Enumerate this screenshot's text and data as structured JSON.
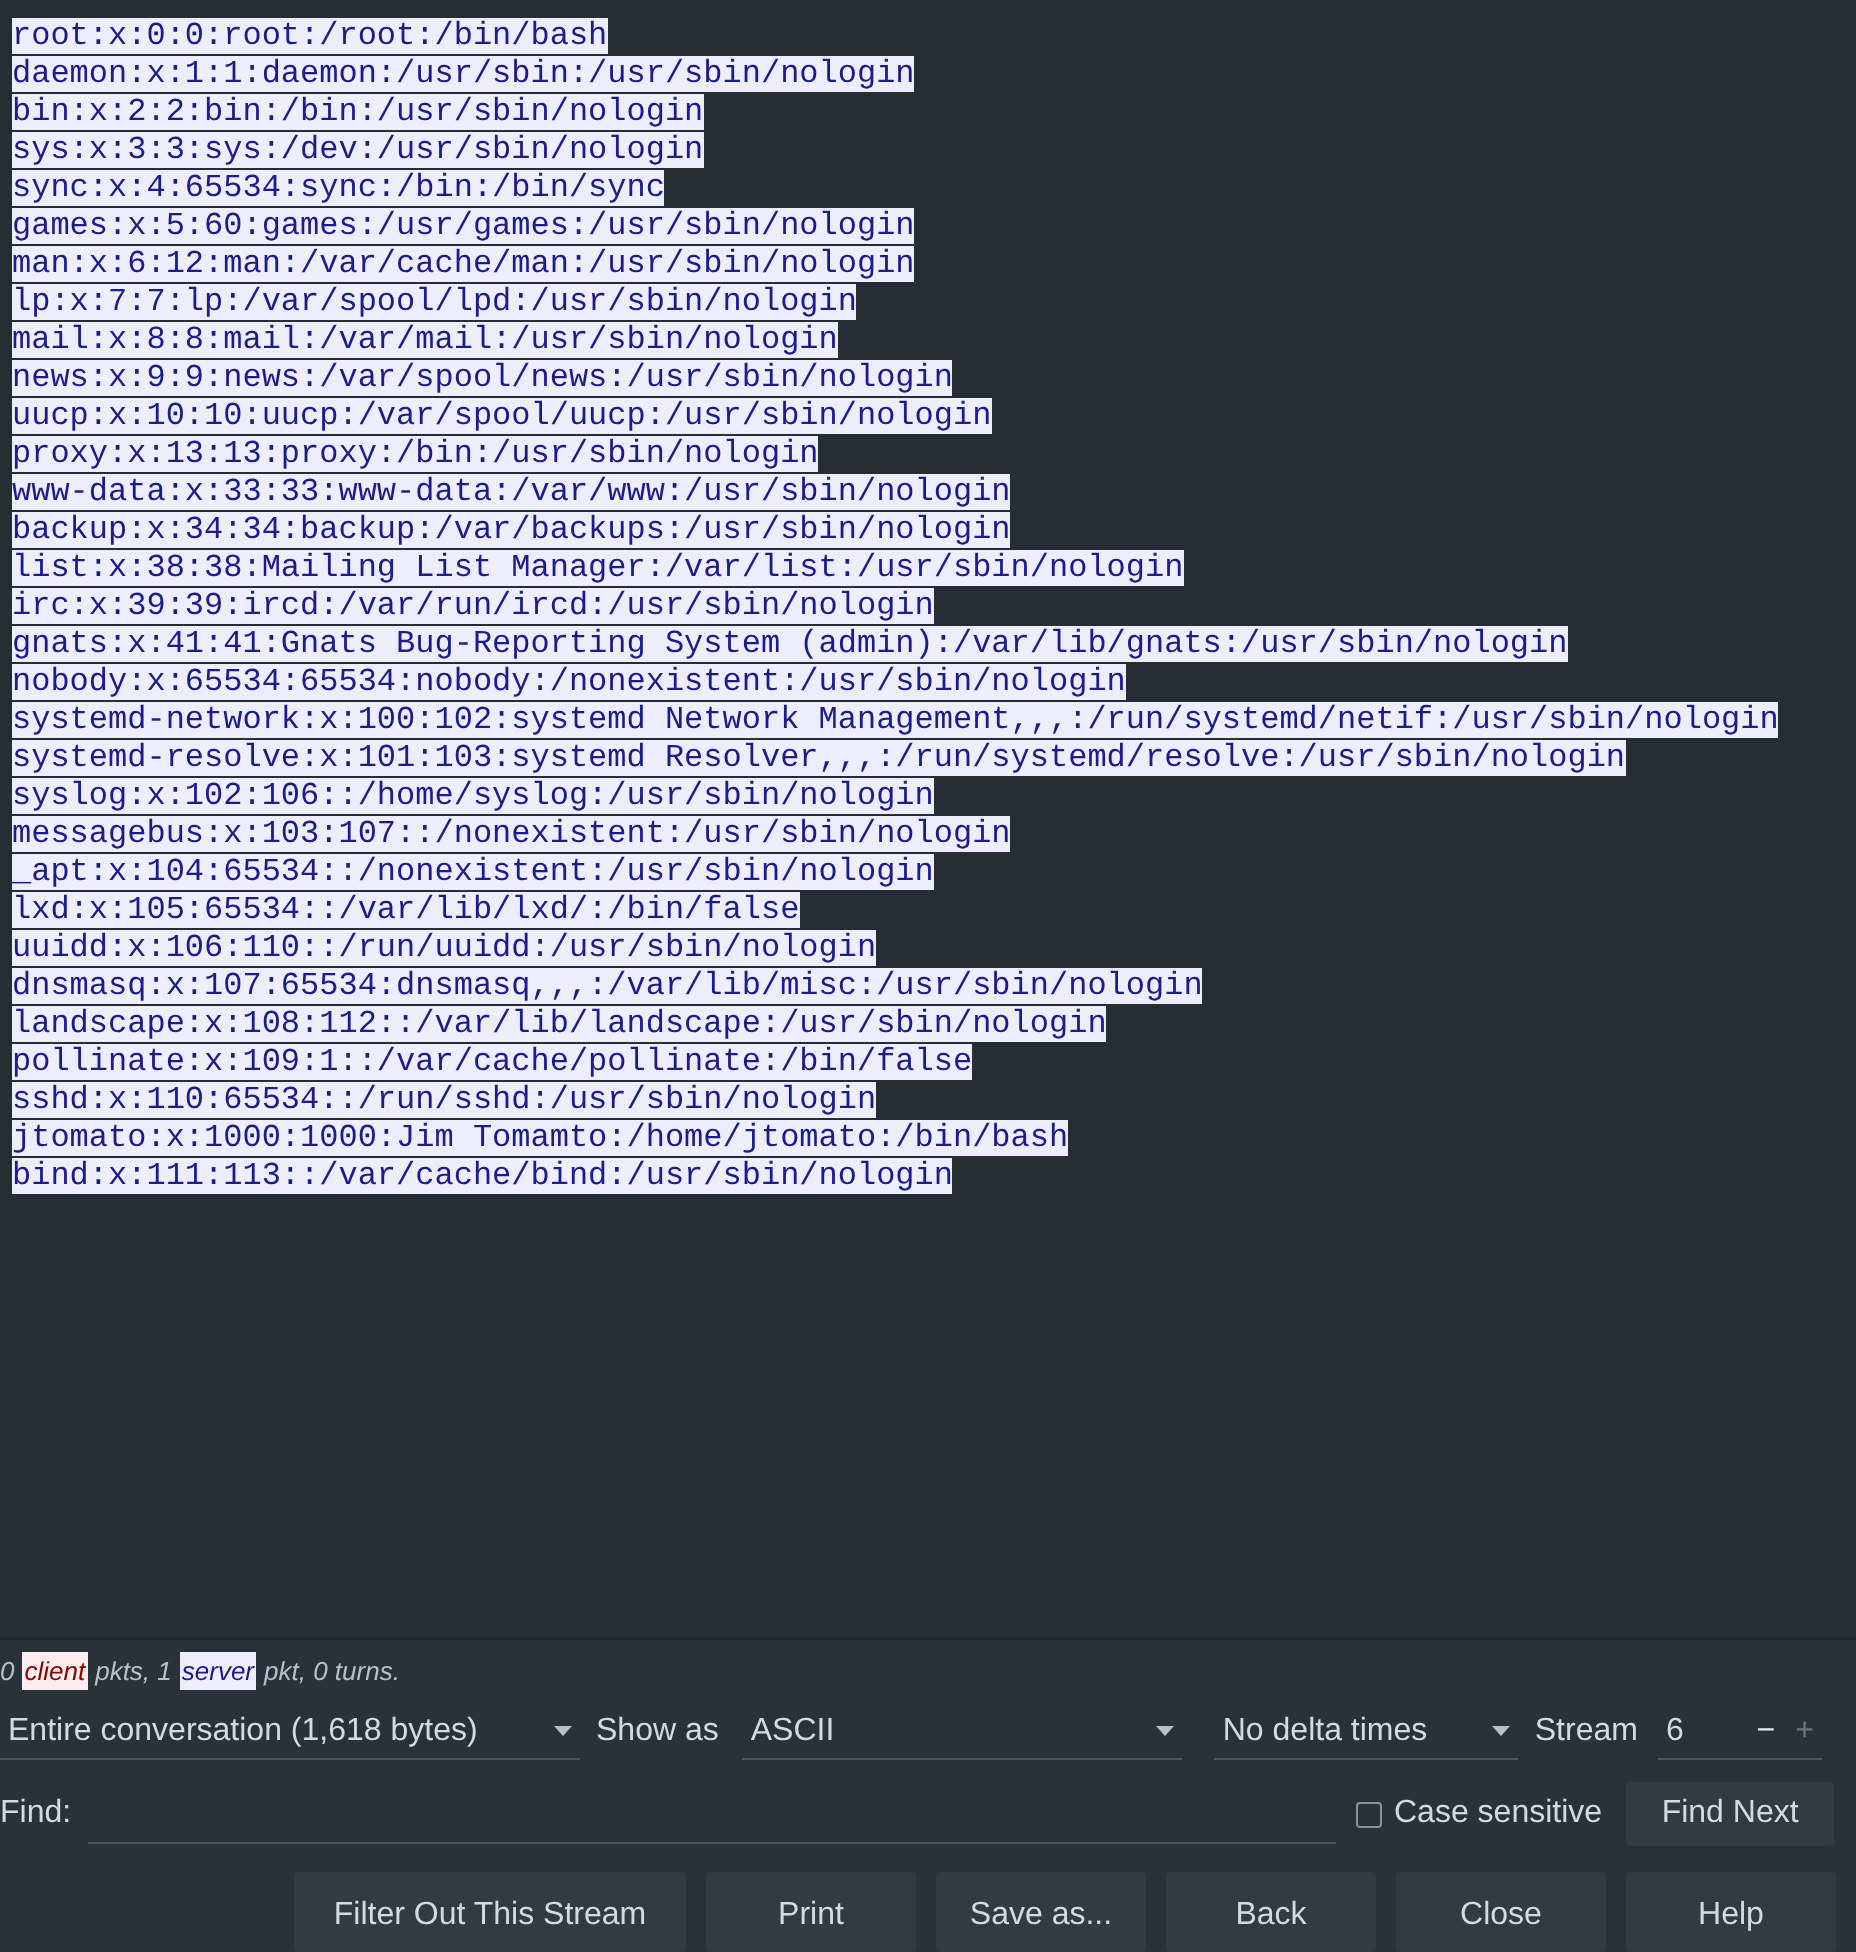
{
  "stream_text": {
    "kind": "server",
    "lines": [
      "root:x:0:0:root:/root:/bin/bash",
      "daemon:x:1:1:daemon:/usr/sbin:/usr/sbin/nologin",
      "bin:x:2:2:bin:/bin:/usr/sbin/nologin",
      "sys:x:3:3:sys:/dev:/usr/sbin/nologin",
      "sync:x:4:65534:sync:/bin:/bin/sync",
      "games:x:5:60:games:/usr/games:/usr/sbin/nologin",
      "man:x:6:12:man:/var/cache/man:/usr/sbin/nologin",
      "lp:x:7:7:lp:/var/spool/lpd:/usr/sbin/nologin",
      "mail:x:8:8:mail:/var/mail:/usr/sbin/nologin",
      "news:x:9:9:news:/var/spool/news:/usr/sbin/nologin",
      "uucp:x:10:10:uucp:/var/spool/uucp:/usr/sbin/nologin",
      "proxy:x:13:13:proxy:/bin:/usr/sbin/nologin",
      "www-data:x:33:33:www-data:/var/www:/usr/sbin/nologin",
      "backup:x:34:34:backup:/var/backups:/usr/sbin/nologin",
      "list:x:38:38:Mailing List Manager:/var/list:/usr/sbin/nologin",
      "irc:x:39:39:ircd:/var/run/ircd:/usr/sbin/nologin",
      "gnats:x:41:41:Gnats Bug-Reporting System (admin):/var/lib/gnats:/usr/sbin/nologin",
      "nobody:x:65534:65534:nobody:/nonexistent:/usr/sbin/nologin",
      "systemd-network:x:100:102:systemd Network Management,,,:/run/systemd/netif:/usr/sbin/nologin",
      "systemd-resolve:x:101:103:systemd Resolver,,,:/run/systemd/resolve:/usr/sbin/nologin",
      "syslog:x:102:106::/home/syslog:/usr/sbin/nologin",
      "messagebus:x:103:107::/nonexistent:/usr/sbin/nologin",
      "_apt:x:104:65534::/nonexistent:/usr/sbin/nologin",
      "lxd:x:105:65534::/var/lib/lxd/:/bin/false",
      "uuidd:x:106:110::/run/uuidd:/usr/sbin/nologin",
      "dnsmasq:x:107:65534:dnsmasq,,,:/var/lib/misc:/usr/sbin/nologin",
      "landscape:x:108:112::/var/lib/landscape:/usr/sbin/nologin",
      "pollinate:x:109:1::/var/cache/pollinate:/bin/false",
      "sshd:x:110:65534::/run/sshd:/usr/sbin/nologin",
      "jtomato:x:1000:1000:Jim Tomamto:/home/jtomato:/bin/bash",
      "bind:x:111:113::/var/cache/bind:/usr/sbin/nologin"
    ]
  },
  "status": [
    {
      "text": "0",
      "kind": "plain"
    },
    {
      "text": "client",
      "kind": "client"
    },
    {
      "text": "pkts, 1",
      "kind": "plain"
    },
    {
      "text": "server",
      "kind": "server"
    },
    {
      "text": "pkt, 0 turns.",
      "kind": "plain"
    }
  ],
  "conversation_select": {
    "value": "Entire conversation (1,618 bytes)"
  },
  "show_as": {
    "label": "Show as",
    "value": "ASCII"
  },
  "delta_select": {
    "value": "No delta times"
  },
  "stream": {
    "label": "Stream",
    "value": "6",
    "decrement": "−",
    "increment": "+"
  },
  "find": {
    "label": "Find:"
  },
  "case_sensitive": {
    "label": "Case sensitive",
    "checked": false
  },
  "find_next": "Find Next",
  "buttons": [
    "Filter Out This Stream",
    "Print",
    "Save as...",
    "Back",
    "Close",
    "Help"
  ]
}
